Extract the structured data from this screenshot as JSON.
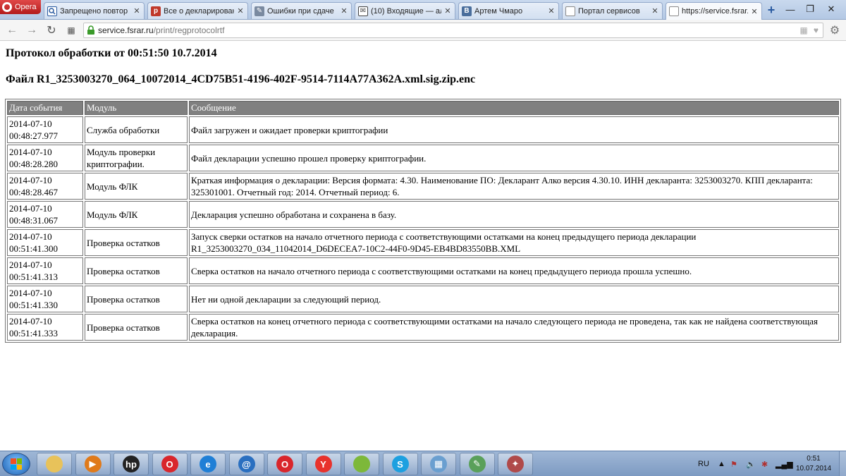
{
  "browser": {
    "app_name": "Opera",
    "tabs": [
      {
        "label": "Запрещено повтор",
        "icon": "search-icon",
        "color": "#ffffff"
      },
      {
        "label": "Все о декларирован",
        "icon": "site-icon",
        "color": "#c0392b"
      },
      {
        "label": "Ошибки при сдаче",
        "icon": "pen-icon",
        "color": "#7a8aa0"
      },
      {
        "label": "(10) Входящие — ал",
        "icon": "mail-icon",
        "color": "#444444"
      },
      {
        "label": "Артем Чмаро",
        "icon": "vk-icon",
        "color": "#4a6e9c"
      },
      {
        "label": "Портал сервисов",
        "icon": "page-icon",
        "color": "#8a8a8a"
      },
      {
        "label": "https://service.fsrar.r",
        "icon": "page-icon",
        "color": "#8a8a8a"
      }
    ],
    "url": {
      "host": "service.fsrar.ru",
      "path": "/print/regprotocolrtf"
    }
  },
  "page": {
    "protocol_title": "Протокол обработки от 00:51:50 10.7.2014",
    "file_title": "Файл R1_3253003270_064_10072014_4CD75B51-4196-402F-9514-7114A77A362A.xml.sig.zip.enc",
    "table": {
      "headers": [
        "Дата события",
        "Модуль",
        "Сообщение"
      ],
      "rows": [
        {
          "date": "2014-07-10",
          "time": "00:48:27.977",
          "module": "Служба обработки",
          "message": "Файл загружен и ожидает проверки криптографии"
        },
        {
          "date": "2014-07-10",
          "time": "00:48:28.280",
          "module": "Модуль проверки криптографии.",
          "message": "Файл декларации успешно прошел проверку криптографии."
        },
        {
          "date": "2014-07-10",
          "time": "00:48:28.467",
          "module": "Модуль ФЛК",
          "message": "Краткая информация о декларации: Версия формата: 4.30. Наименование ПО: Декларант Алко версия 4.30.10. ИНН декларанта: 3253003270. КПП декларанта: 325301001. Отчетный год: 2014. Отчетный период: 6."
        },
        {
          "date": "2014-07-10",
          "time": "00:48:31.067",
          "module": "Модуль ФЛК",
          "message": "Декларация успешно обработана и сохранена в базу."
        },
        {
          "date": "2014-07-10",
          "time": "00:51:41.300",
          "module": "Проверка остатков",
          "message": "Запуск сверки остатков на начало отчетного периода с соответствующими остатками на конец предыдущего периода декларации R1_3253003270_034_11042014_D6DECEA7-10C2-44F0-9D45-EB4BD83550BB.XML"
        },
        {
          "date": "2014-07-10",
          "time": "00:51:41.313",
          "module": "Проверка остатков",
          "message": "Сверка остатков на начало отчетного периода с соответствующими остатками на конец предыдущего периода прошла успешно."
        },
        {
          "date": "2014-07-10",
          "time": "00:51:41.330",
          "module": "Проверка остатков",
          "message": "Нет ни одной декларации за следующий период."
        },
        {
          "date": "2014-07-10",
          "time": "00:51:41.333",
          "module": "Проверка остатков",
          "message": "Сверка остатков на конец отчетного периода с соответствующими остатками на начало следующего периода не проведена, так как не найдена соответствующая декларация."
        }
      ]
    }
  },
  "taskbar": {
    "apps": [
      {
        "name": "file-explorer-icon",
        "color": "#e8c25a",
        "glyph": ""
      },
      {
        "name": "media-player-icon",
        "color": "#e07a1a",
        "glyph": "▶"
      },
      {
        "name": "hp-icon",
        "color": "#222222",
        "glyph": "hp"
      },
      {
        "name": "opera-icon",
        "color": "#d9262c",
        "glyph": "O"
      },
      {
        "name": "internet-explorer-icon",
        "color": "#1f7fd6",
        "glyph": "e"
      },
      {
        "name": "mail-at-icon",
        "color": "#2a6fc0",
        "glyph": "@"
      },
      {
        "name": "opera-active-icon",
        "color": "#d9262c",
        "glyph": "O"
      },
      {
        "name": "yandex-browser-icon",
        "color": "#e8322c",
        "glyph": "Y"
      },
      {
        "name": "app-ball-icon",
        "color": "#7db83a",
        "glyph": ""
      },
      {
        "name": "skype-icon",
        "color": "#1da0e0",
        "glyph": "S"
      },
      {
        "name": "calculator-icon",
        "color": "#6a9fd0",
        "glyph": "▦"
      },
      {
        "name": "declarant-icon",
        "color": "#5aa05a",
        "glyph": "✎"
      },
      {
        "name": "tool-icon",
        "color": "#b04a4a",
        "glyph": "✦"
      }
    ],
    "language": "RU",
    "time": "0:51",
    "date": "10.07.2014"
  }
}
